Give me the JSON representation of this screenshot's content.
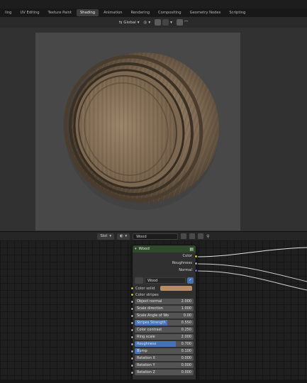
{
  "tabs": [
    "ling",
    "UV Editing",
    "Texture Paint",
    "Shading",
    "Animation",
    "Rendering",
    "Compositing",
    "Geometry Nodes",
    "Scripting"
  ],
  "active_tab": 3,
  "viewport_header": {
    "shading_mode": "Global"
  },
  "node_editor_header": {
    "slot": "Slot",
    "material": "Wood"
  },
  "node": {
    "title": "Wood",
    "outputs": [
      {
        "label": "Color",
        "socket": "yellow"
      },
      {
        "label": "Roughness",
        "socket": "gray"
      },
      {
        "label": "Normal",
        "socket": "purple"
      }
    ],
    "group": "Wood",
    "color_inputs": [
      {
        "label": "Color solid",
        "swatch": "#b98d63"
      },
      {
        "label": "Color stripes"
      }
    ],
    "sliders": [
      {
        "label": "Object normal",
        "value": "2.000",
        "fill": 0
      },
      {
        "label": "Scale direction",
        "value": "1.000",
        "fill": 0
      },
      {
        "label": "Scale Angle of Wo",
        "value": "0.00",
        "fill": 0
      },
      {
        "label": "Stripes Strength",
        "value": "0.550",
        "fill": 0.55
      },
      {
        "label": "Color contrast",
        "value": "0.250",
        "fill": 0
      },
      {
        "label": "Ring scale",
        "value": "2.000",
        "fill": 0
      },
      {
        "label": "Roughness",
        "value": "0.700",
        "fill": 0.7
      },
      {
        "label": "Bump",
        "value": "0.100",
        "fill": 0.1
      },
      {
        "label": "Rotation X",
        "value": "0.000",
        "fill": 0
      },
      {
        "label": "Rotation Y",
        "value": "0.000",
        "fill": 0
      },
      {
        "label": "Rotation Z",
        "value": "0.000",
        "fill": 0
      }
    ]
  }
}
